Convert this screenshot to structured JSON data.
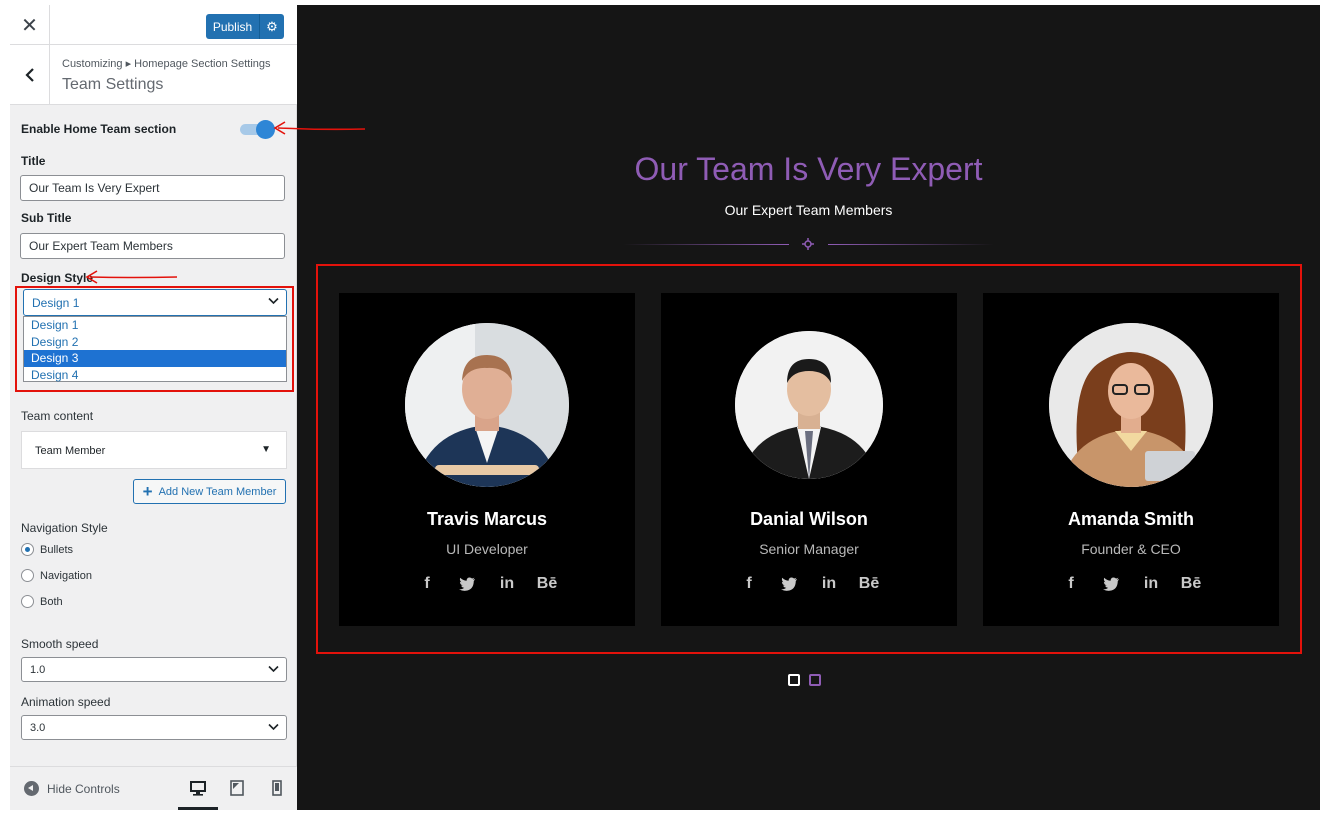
{
  "header": {
    "publish_label": "Publish"
  },
  "section": {
    "breadcrumb": "Customizing ▸ Homepage Section Settings",
    "title": "Team Settings"
  },
  "controls": {
    "enable_label": "Enable Home Team section",
    "title_label": "Title",
    "title_value": "Our Team Is Very Expert",
    "subtitle_label": "Sub Title",
    "subtitle_value": "Our Expert Team Members",
    "design_label": "Design Style",
    "design_selected": "Design 1",
    "design_options": [
      "Design 1",
      "Design 2",
      "Design 3",
      "Design 4"
    ],
    "team_content_label": "Team content",
    "team_member_label": "Team Member",
    "add_member_label": "Add New Team Member",
    "nav_style_label": "Navigation Style",
    "nav_options": [
      "Bullets",
      "Navigation",
      "Both"
    ],
    "smooth_label": "Smooth speed",
    "smooth_value": "1.0",
    "anim_label": "Animation speed",
    "anim_value": "3.0"
  },
  "footer": {
    "hide_label": "Hide Controls"
  },
  "preview": {
    "title": "Our Team Is Very Expert",
    "subtitle": "Our Expert Team Members",
    "members": [
      {
        "name": "Travis Marcus",
        "role": "UI Developer"
      },
      {
        "name": "Danial Wilson",
        "role": "Senior Manager"
      },
      {
        "name": "Amanda Smith",
        "role": "Founder & CEO"
      }
    ],
    "social_labels": [
      "f",
      "in",
      "Bē"
    ]
  },
  "colors": {
    "accent": "#8f5cb5",
    "wp_blue": "#2271b1",
    "annotation_red": "#e3120b"
  }
}
